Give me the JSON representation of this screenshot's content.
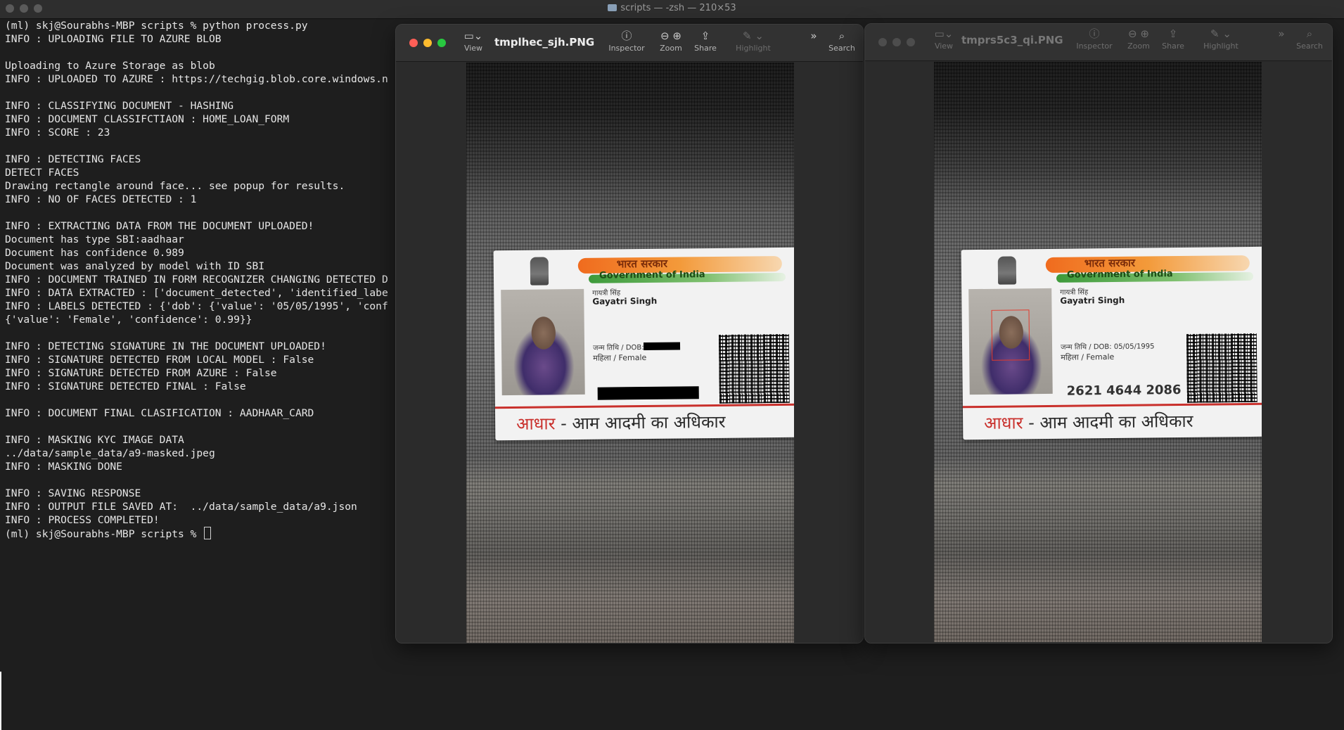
{
  "terminal": {
    "title": "scripts — -zsh — 210×53",
    "lines": [
      "(ml) skj@Sourabhs-MBP scripts % python process.py",
      "INFO : UPLOADING FILE TO AZURE BLOB",
      "",
      "Uploading to Azure Storage as blob",
      "INFO : UPLOADED TO AZURE : https://techgig.blob.core.windows.n",
      "",
      "INFO : CLASSIFYING DOCUMENT - HASHING",
      "INFO : DOCUMENT CLASSIFCTIAON : HOME_LOAN_FORM",
      "INFO : SCORE : 23",
      "",
      "INFO : DETECTING FACES",
      "DETECT FACES",
      "Drawing rectangle around face... see popup for results.",
      "INFO : NO OF FACES DETECTED : 1",
      "",
      "INFO : EXTRACTING DATA FROM THE DOCUMENT UPLOADED!",
      "Document has type SBI:aadhaar",
      "Document has confidence 0.989",
      "Document was analyzed by model with ID SBI",
      "INFO : DOCUMENT TRAINED IN FORM RECOGNIZER CHANGING DETECTED D",
      "INFO : DATA EXTRACTED : ['document_detected', 'identified_labe",
      "INFO : LABELS DETECTED : {'dob': {'value': '05/05/1995', 'conf",
      "{'value': 'Female', 'confidence': 0.99}}",
      "",
      "INFO : DETECTING SIGNATURE IN THE DOCUMENT UPLOADED!",
      "INFO : SIGNATURE DETECTED FROM LOCAL MODEL : False",
      "INFO : SIGNATURE DETECTED FROM AZURE : False",
      "INFO : SIGNATURE DETECTED FINAL : False",
      "",
      "INFO : DOCUMENT FINAL CLASIFICATION : AADHAAR_CARD",
      "",
      "INFO : MASKING KYC IMAGE DATA",
      "../data/sample_data/a9-masked.jpeg",
      "INFO : MASKING DONE",
      "",
      "INFO : SAVING RESPONSE",
      "INFO : OUTPUT FILE SAVED AT:  ../data/sample_data/a9.json",
      "INFO : PROCESS COMPLETED!"
    ],
    "prompt": "(ml) skj@Sourabhs-MBP scripts % "
  },
  "toolbar_labels": {
    "view": "View",
    "inspector": "Inspector",
    "zoom": "Zoom",
    "share": "Share",
    "highlight": "Highlight",
    "search": "Search"
  },
  "preview_one": {
    "filename": "tmplhec_sjh.PNG",
    "focused": true
  },
  "preview_two": {
    "filename": "tmprs5c3_qi.PNG",
    "focused": false
  },
  "card": {
    "hindi_gov": "भारत सरकार",
    "english_gov": "Government of India",
    "name_hindi": "गायत्री सिंह",
    "name": "Gayatri Singh",
    "dob_label": "जन्म तिथि / DOB:",
    "dob_value": "05/05/1995",
    "gender": "महिला / Female",
    "uid": "2621 4644 2086",
    "tagline_red": "आधार",
    "tagline_rest": " - आम आदमी का अधिकार"
  },
  "colors": {
    "close": "#ff5f57",
    "minimize": "#febc2e",
    "zoom": "#28c840",
    "face_box": "#e33a2c",
    "terminal_bg": "#1e1e1e"
  }
}
